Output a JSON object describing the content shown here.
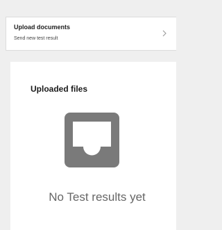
{
  "upload": {
    "title": "Upload documents",
    "subtitle": "Send new test result",
    "chevron_icon": "chevron-right-icon"
  },
  "files": {
    "title": "Uploaded files",
    "empty_icon": "inbox-tray-icon",
    "empty_message": "No Test results yet"
  },
  "colors": {
    "page_background": "#efefef",
    "card_background": "#ffffff",
    "icon": "#7a7a7a",
    "empty_text": "#666666"
  }
}
